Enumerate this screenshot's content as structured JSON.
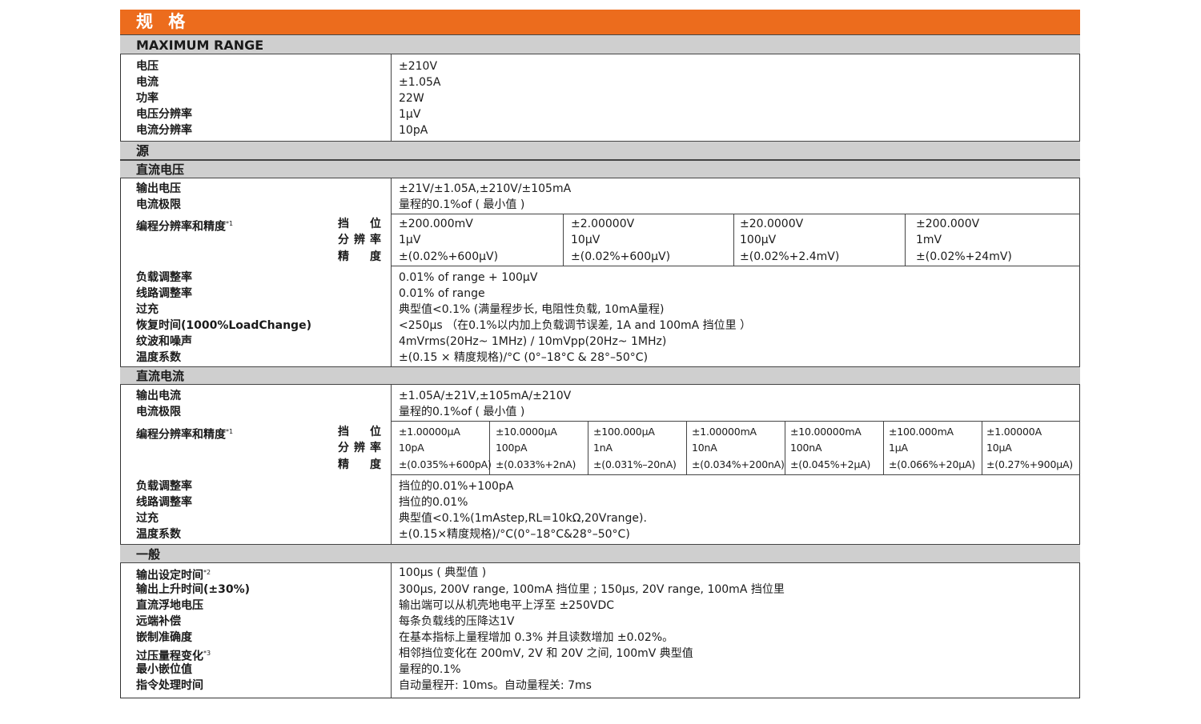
{
  "title": "规 格",
  "max_range": {
    "heading": "MAXIMUM RANGE",
    "rows": [
      {
        "label": "电压",
        "value": "±210V"
      },
      {
        "label": "电流",
        "value": "±1.05A"
      },
      {
        "label": "功率",
        "value": "22W"
      },
      {
        "label": "电压分辨率",
        "value": "1μV"
      },
      {
        "label": "电流分辨率",
        "value": "10pA"
      }
    ]
  },
  "source_heading": "源",
  "dcv": {
    "heading": "直流电压",
    "rows_top": [
      {
        "label": "输出电压",
        "value": "±21V/±1.05A,±210V/±105mA"
      },
      {
        "label": "电流极限",
        "value": "量程的0.1%of ( 最小值 )"
      }
    ],
    "prog_label": "编程分辨率和精度",
    "prog_note": "*1",
    "range_labels": [
      "挡位",
      "分辨率",
      "精度"
    ],
    "ranges": [
      {
        "range": "±200.000mV",
        "resolution": "1μV",
        "accuracy": "±(0.02%+600μV)"
      },
      {
        "range": "±2.00000V",
        "resolution": "10μV",
        "accuracy": "±(0.02%+600μV)"
      },
      {
        "range": "±20.0000V",
        "resolution": "100μV",
        "accuracy": "±(0.02%+2.4mV)"
      },
      {
        "range": "±200.000V",
        "resolution": "1mV",
        "accuracy": "±(0.02%+24mV)"
      }
    ],
    "rows_bottom": [
      {
        "label": "负载调整率",
        "value": "0.01% of range + 100μV"
      },
      {
        "label": "线路调整率",
        "value": "0.01% of range"
      },
      {
        "label": "过充",
        "value": "典型值<0.1% (满量程步长, 电阻性负载, 10mA量程)"
      },
      {
        "label": "恢复时间(1000%LoadChange)",
        "value": "<250μs （在0.1%以内加上负载调节误差, 1A and 100mA 挡位里 ）"
      },
      {
        "label": "纹波和噪声",
        "value": "4mVrms(20Hz~ 1MHz) / 10mVpp(20Hz~ 1MHz)"
      },
      {
        "label": "温度系数",
        "value": "±(0.15 × 精度规格)/°C  (0°–18°C & 28°–50°C)"
      }
    ]
  },
  "dci": {
    "heading": "直流电流",
    "rows_top": [
      {
        "label": "输出电流",
        "value": "±1.05A/±21V,±105mA/±210V"
      },
      {
        "label": "电流极限",
        "value": "量程的0.1%of ( 最小值 )"
      }
    ],
    "prog_label": "编程分辨率和精度",
    "prog_note": "*1",
    "range_labels": [
      "挡位",
      "分辨率",
      "精度"
    ],
    "ranges": [
      {
        "range": "±1.00000μA",
        "resolution": "10pA",
        "accuracy": "±(0.035%+600pA)"
      },
      {
        "range": "±10.0000μA",
        "resolution": "100pA",
        "accuracy": "±(0.033%+2nA)"
      },
      {
        "range": "±100.000μA",
        "resolution": "1nA",
        "accuracy": "±(0.031%–20nA)"
      },
      {
        "range": "±1.00000mA",
        "resolution": "10nA",
        "accuracy": "±(0.034%+200nA)"
      },
      {
        "range": "±10.00000mA",
        "resolution": "100nA",
        "accuracy": "±(0.045%+2μA)"
      },
      {
        "range": "±100.000mA",
        "resolution": "1μA",
        "accuracy": "±(0.066%+20μA)"
      },
      {
        "range": "±1.00000A",
        "resolution": "10μA",
        "accuracy": "±(0.27%+900μA)"
      }
    ],
    "rows_bottom": [
      {
        "label": "负载调整率",
        "value": "挡位的0.01%+100pA"
      },
      {
        "label": "线路调整率",
        "value": "挡位的0.01%"
      },
      {
        "label": "过充",
        "value": "典型值<0.1%(1mAstep,RL=10kΩ,20Vrange)."
      },
      {
        "label": "温度系数",
        "value": "±(0.15×精度规格)/°C(0°–18°C&28°–50°C)"
      }
    ]
  },
  "general": {
    "heading": "一般",
    "rows": [
      {
        "label": "输出设定时间",
        "note": "*2",
        "value": "100μs ( 典型值 )"
      },
      {
        "label": "输出上升时间(±30%)",
        "note": "",
        "value": "300μs, 200V range, 100mA 挡位里 ; 150μs, 20V range, 100mA 挡位里"
      },
      {
        "label": "直流浮地电压",
        "note": "",
        "value": "输出端可以从机壳地电平上浮至 ±250VDC"
      },
      {
        "label": "远端补偿",
        "note": "",
        "value": "每条负载线的压降达1V"
      },
      {
        "label": "嵌制准确度",
        "note": "",
        "value": "在基本指标上量程增加 0.3% 并且读数增加 ±0.02%。"
      },
      {
        "label": "过压量程变化",
        "note": "*3",
        "value": "相邻挡位变化在 200mV, 2V 和 20V 之间, 100mV 典型值"
      },
      {
        "label": "最小嵌位值",
        "note": "",
        "value": "量程的0.1%"
      },
      {
        "label": "指令处理时间",
        "note": "",
        "value": "自动量程开: 10ms。自动量程关: 7ms"
      }
    ]
  }
}
